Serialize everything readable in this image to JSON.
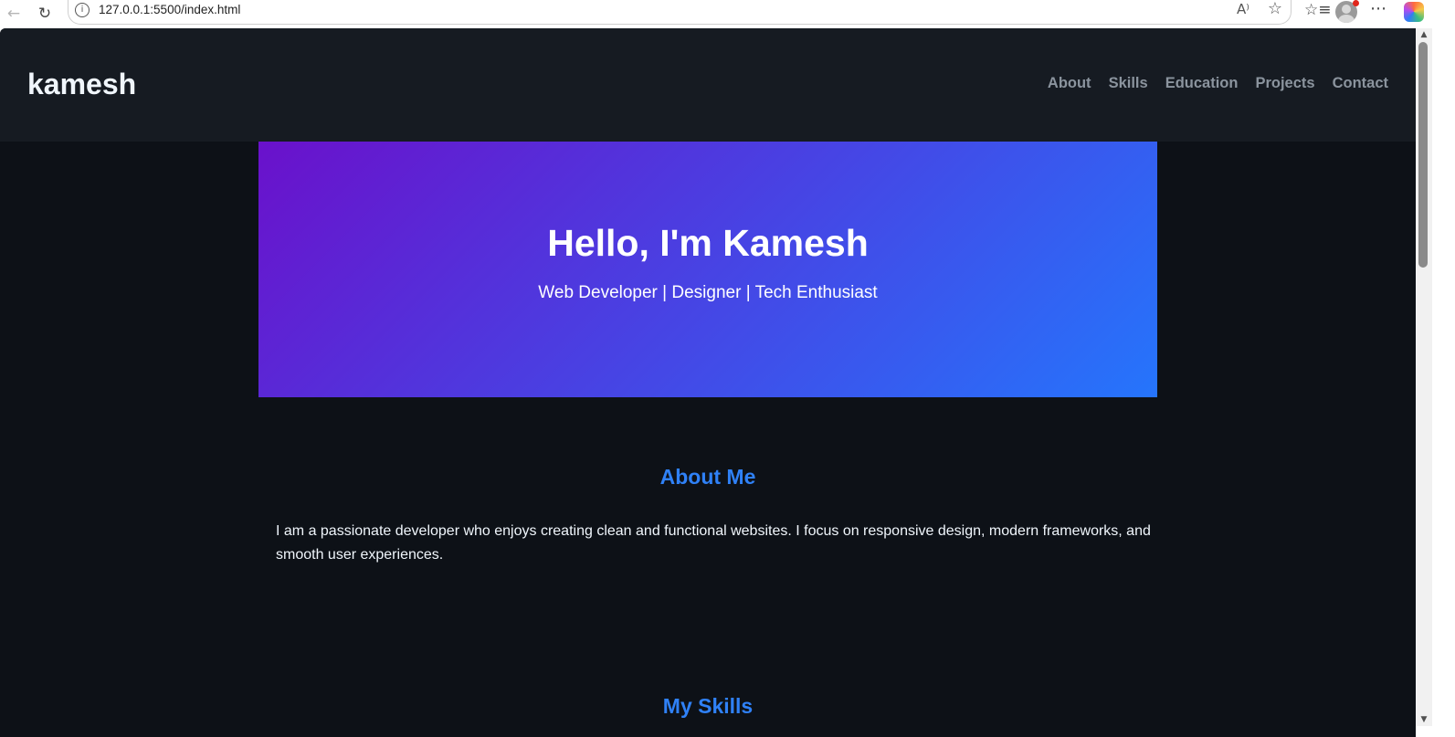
{
  "browser": {
    "url": "127.0.0.1:5500/index.html",
    "back_icon": "back-arrow-icon",
    "reload_icon": "reload-icon",
    "read_aloud_icon": "read-aloud-icon",
    "favorite_icon": "star-icon",
    "favorites_icon": "favorites-list-icon",
    "profile_icon": "profile-avatar-icon",
    "more_icon": "more-dots-icon",
    "copilot_icon": "copilot-icon"
  },
  "site": {
    "logo": "kamesh",
    "nav": [
      "About",
      "Skills",
      "Education",
      "Projects",
      "Contact"
    ]
  },
  "hero": {
    "title": "Hello, I'm Kamesh",
    "subtitle": "Web Developer | Designer | Tech Enthusiast",
    "gradient_start": "#6a11cb",
    "gradient_end": "#2575fc"
  },
  "about": {
    "title": "About Me",
    "text": "I am a passionate developer who enjoys creating clean and functional websites. I focus on responsive design, modern frameworks, and smooth user experiences."
  },
  "skills": {
    "title": "My Skills"
  },
  "colors": {
    "page_bg": "#0d1117",
    "header_bg": "#161b22",
    "accent": "#2f81f7",
    "nav_text": "#8b949e"
  }
}
